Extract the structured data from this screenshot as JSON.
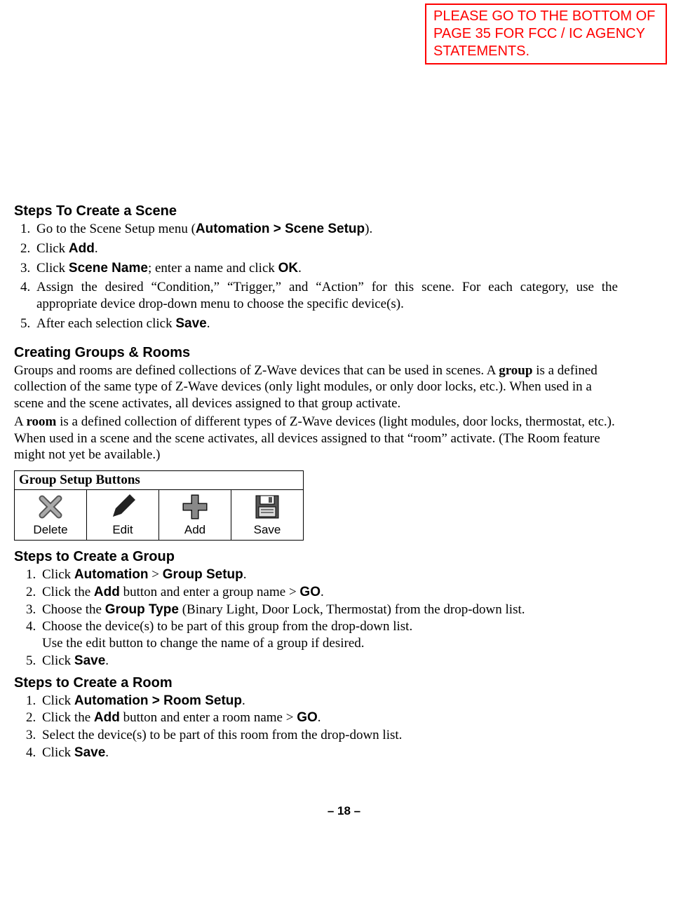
{
  "notice": "PLEASE GO TO THE BOTTOM OF PAGE 35 FOR FCC / IC AGENCY STATEMENTS.",
  "sceneHeading": "Steps To Create a Scene",
  "sceneSteps": {
    "s1_pre": "Go to the Scene Setup menu (",
    "s1_bold": "Automation > Scene Setup",
    "s1_post": ").",
    "s2_pre": "Click ",
    "s2_bold": "Add",
    "s2_post": ".",
    "s3_pre": "Click ",
    "s3_bold1": "Scene Name",
    "s3_mid": "; enter a name and click ",
    "s3_bold2": "OK",
    "s3_post": ".",
    "s4": "Assign the desired “Condition,” “Trigger,” and “Action” for this scene. For each category, use the appropriate device drop-down menu to choose the specific device(s).",
    "s5_pre": "After each selection click ",
    "s5_bold": "Save",
    "s5_post": "."
  },
  "groupsRoomsHeading": "Creating Groups & Rooms",
  "groupsRoomsPara1_pre": "Groups and rooms are defined collections of Z-Wave devices that can be used in scenes. A ",
  "groupsRoomsPara1_bold": "group",
  "groupsRoomsPara1_post": " is a defined collection of the same type of Z-Wave devices (only light modules, or only door locks, etc.). When used in a scene and the scene activates, all devices assigned to that group activate.",
  "groupsRoomsPara2_pre": "A ",
  "groupsRoomsPara2_bold": "room",
  "groupsRoomsPara2_post": " is a defined collection of different types of Z-Wave devices (light modules, door locks, thermostat, etc.). When used in a scene and the scene activates, all devices assigned to that “room” activate. (The Room feature might not yet be available.)",
  "tableHeader": "Group Setup Buttons",
  "buttons": {
    "delete": "Delete",
    "edit": "Edit",
    "add": "Add",
    "save": "Save"
  },
  "createGroupHeading": "Steps to Create a Group",
  "groupSteps": {
    "s1_pre": "Click ",
    "s1_bold": "Automation",
    "s1_mid": " > ",
    "s1_bold2": "Group Setup",
    "s1_post": ".",
    "s2_pre": "Click the ",
    "s2_bold": "Add",
    "s2_mid": " button and enter a group name > ",
    "s2_bold2": "GO",
    "s2_post": ".",
    "s3_pre": "Choose the ",
    "s3_bold": "Group Type",
    "s3_post": " (Binary Light, Door Lock, Thermostat) from the drop-down list.",
    "s4": "Choose the device(s) to be part of this group from the drop-down list.",
    "s4b": "Use the edit button to change the name of a group if desired.",
    "s5_pre": "Click ",
    "s5_bold": "Save",
    "s5_post": "."
  },
  "createRoomHeading": "Steps to Create a Room",
  "roomSteps": {
    "s1_pre": "Click ",
    "s1_bold": "Automation > Room Setup",
    "s1_post": ".",
    "s2_pre": "Click the ",
    "s2_bold": "Add",
    "s2_mid": " button and enter a room name > ",
    "s2_bold2": "GO",
    "s2_post": ".",
    "s3": "Select the device(s) to be part of this room from the drop-down list.",
    "s4_pre": "Click ",
    "s4_bold": "Save",
    "s4_post": "."
  },
  "pageNumber": "– 18 –"
}
